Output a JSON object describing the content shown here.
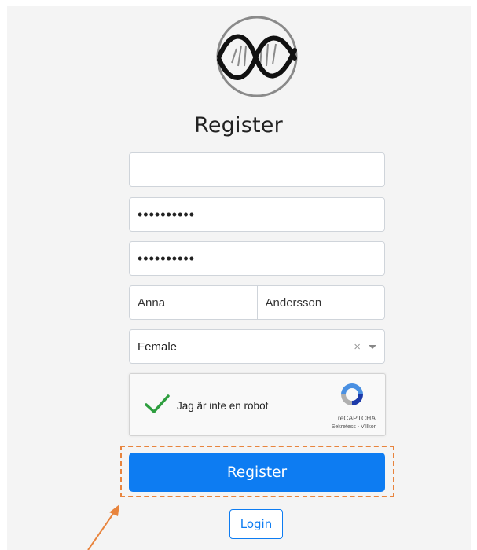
{
  "header": {
    "title": "Register",
    "logo_icon": "dna-helix-logo"
  },
  "form": {
    "email_value": "",
    "password_value": "••••••••••",
    "confirm_password_value": "••••••••••",
    "first_name_value": "Anna",
    "last_name_value": "Andersson",
    "gender": {
      "selected": "Female",
      "clear_glyph": "×",
      "options": [
        "Female"
      ]
    },
    "captcha": {
      "label": "Jag är inte en robot",
      "brand": "reCAPTCHA",
      "links": "Sekretess - Villkor",
      "checked": true
    },
    "register_button_label": "Register",
    "login_button_label": "Login"
  },
  "annotation": {
    "highlight_color": "#e8843d",
    "arrow_color": "#e8843d"
  },
  "colors": {
    "primary": "#0d7cf2",
    "check": "#2e9e3f",
    "panel": "#f4f4f4"
  }
}
